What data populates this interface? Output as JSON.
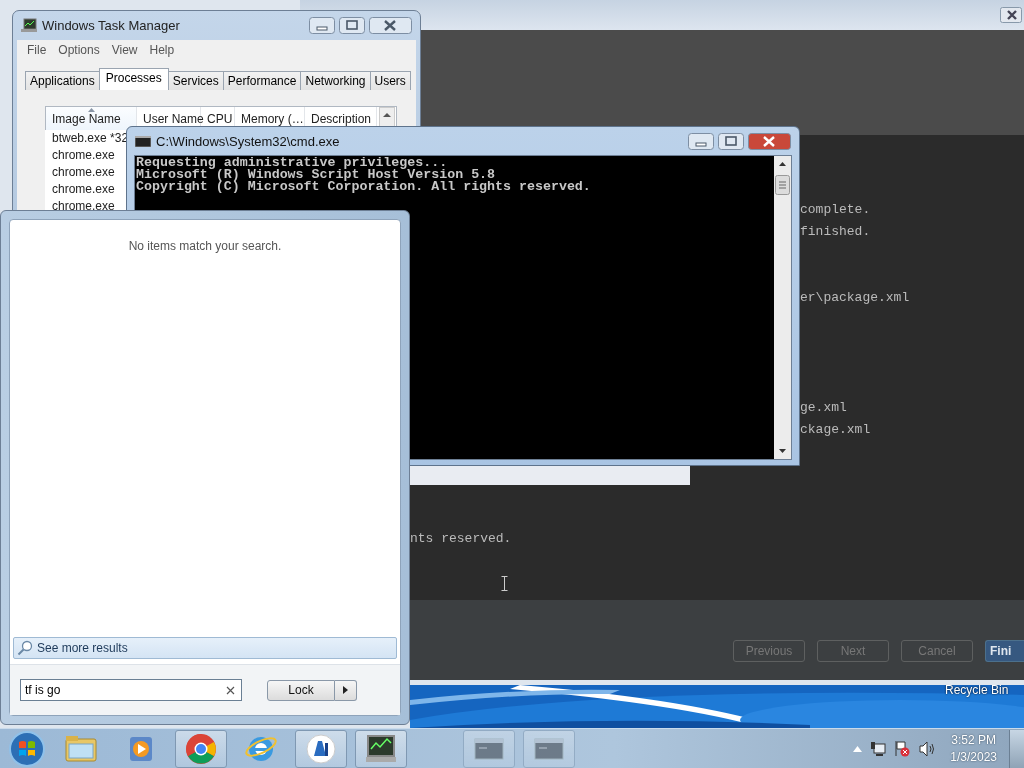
{
  "ide_window": {
    "console_lines": [
      {
        "text": "complete."
      },
      {
        "text": "finished."
      },
      {
        "text": "er\\package.xml"
      },
      {
        "text": "ge.xml"
      },
      {
        "text": "ckage.xml"
      }
    ],
    "lower_lines": [
      {
        "text": "nts reserved."
      }
    ],
    "footer_buttons": [
      {
        "label": "Previous",
        "primary": false
      },
      {
        "label": "Next",
        "primary": false
      },
      {
        "label": "Cancel",
        "primary": false
      },
      {
        "label": "Fini",
        "primary": true
      }
    ]
  },
  "desktop_icons": [
    {
      "label": "Recycle Bin"
    }
  ],
  "task_manager": {
    "title": "Windows Task Manager",
    "menu": [
      "File",
      "Options",
      "View",
      "Help"
    ],
    "tabs": [
      {
        "label": "Applications",
        "selected": false
      },
      {
        "label": "Processes",
        "selected": true
      },
      {
        "label": "Services",
        "selected": false
      },
      {
        "label": "Performance",
        "selected": false
      },
      {
        "label": "Networking",
        "selected": false
      },
      {
        "label": "Users",
        "selected": false
      }
    ],
    "columns": [
      {
        "label": "Image Name",
        "sorted": true
      },
      {
        "label": "User Name",
        "sorted": false
      },
      {
        "label": "CPU",
        "sorted": false
      },
      {
        "label": "Memory (…",
        "sorted": false
      },
      {
        "label": "Description",
        "sorted": false
      }
    ],
    "rows": [
      "btweb.exe *32",
      "chrome.exe",
      "chrome.exe",
      "chrome.exe",
      "chrome.exe"
    ]
  },
  "cmd_window": {
    "title": "C:\\Windows\\System32\\cmd.exe",
    "lines": [
      "Requesting administrative privileges...",
      "Microsoft (R) Windows Script Host Version 5.8",
      "Copyright (C) Microsoft Corporation. All rights reserved."
    ]
  },
  "start_menu": {
    "message": "No items match your search.",
    "see_more": "See more results",
    "search": {
      "value": "tf is go"
    },
    "power_button": "Lock"
  },
  "taskbar": {
    "apps": [
      {
        "kind": "explorer",
        "active": false
      },
      {
        "kind": "media",
        "active": false
      },
      {
        "kind": "chrome",
        "active": true
      },
      {
        "kind": "ie",
        "active": false
      },
      {
        "kind": "editor",
        "active": true
      },
      {
        "kind": "taskmgr",
        "active": true
      },
      {
        "kind": "console",
        "active": true
      },
      {
        "kind": "console",
        "active": true
      }
    ],
    "clock": {
      "time": "3:52 PM",
      "date": "1/3/2023"
    }
  }
}
